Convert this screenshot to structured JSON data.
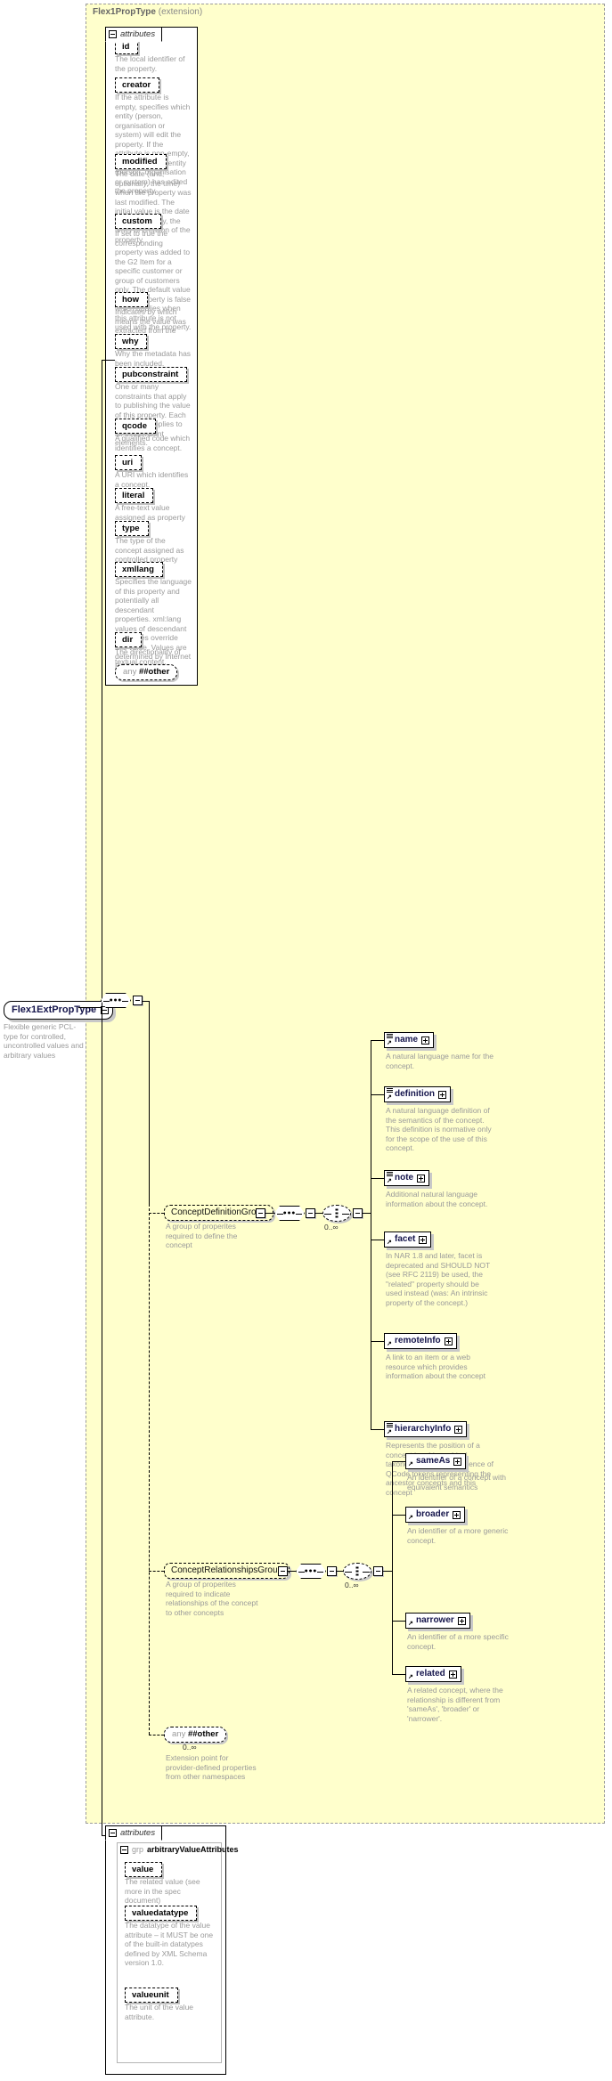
{
  "diagram": {
    "kind": "xml-schema-element-diagram",
    "root": {
      "name": "Flex1ExtPropType",
      "doc": "Flexible generic PCL-type for controlled, uncontrolled values and arbitrary values",
      "toggle": "minus"
    },
    "extension_panel": {
      "title": "Flex1PropType",
      "title_suffix": "(extension)"
    },
    "attributes_label": "attributes",
    "attributes": [
      {
        "name": "id",
        "doc": "The local identifier of the property."
      },
      {
        "name": "creator",
        "doc": "If the attribute is empty, specifies which entity (person, organisation or system) will edit the property. If the attribute is non-empty, specifies which entity (person, organisation or system) has edited the property."
      },
      {
        "name": "modified",
        "doc": "The date (and, optionally, the time) when the property was last modified. The initial value is the date (and, optionally, the time) of creation of the property."
      },
      {
        "name": "custom",
        "doc": "If set to true the corresponding property was added to the G2 Item for a specific customer or group of customers only. The default value of this property is false which applies when this attribute is not used with the property."
      },
      {
        "name": "how",
        "doc": "Indicates by which means the value was extracted from the content."
      },
      {
        "name": "why",
        "doc": "Why the metadata has been included."
      },
      {
        "name": "pubconstraint",
        "doc": "One or many constraints that apply to publishing the value of this property. Each constraint applies to all descendant elements."
      },
      {
        "name": "qcode",
        "doc": "A qualified code which identifies a concept."
      },
      {
        "name": "uri",
        "doc": "A URI which identifies a concept."
      },
      {
        "name": "literal",
        "doc": "A free-text value assigned as property value."
      },
      {
        "name": "type",
        "doc": "The type of the concept assigned as controlled property value."
      },
      {
        "name": "xmllang",
        "doc": "Specifies the language of this property and potentially all descendant properties. xml:lang values of descendant properties override this value. Values are determined by Internet BCP 47."
      },
      {
        "name": "dir",
        "doc": "The directionality of textual content."
      }
    ],
    "attributes_any": {
      "keyword": "any",
      "namespace": "##other"
    },
    "groups": [
      {
        "name": "ConceptDefinitionGroup",
        "doc": "A group of properites required to define the concept",
        "occurrence": "0..∞",
        "elements": [
          {
            "name": "name",
            "doc": "A natural language name for the concept.",
            "toggle": "plus",
            "has_seq_glyph": true
          },
          {
            "name": "definition",
            "doc": "A natural language definition of the semantics of the concept. This definition is normative only for the scope of the use of this concept.",
            "toggle": "plus",
            "has_seq_glyph": true
          },
          {
            "name": "note",
            "doc": "Additional natural language information about the concept.",
            "toggle": "plus",
            "has_seq_glyph": true
          },
          {
            "name": "facet",
            "doc": "In NAR 1.8 and later, facet is deprecated and SHOULD NOT (see RFC 2119) be used, the \"related\" property should be used instead (was: An intrinsic property of the concept.)",
            "toggle": "plus",
            "has_seq_glyph": false
          },
          {
            "name": "remoteInfo",
            "doc": "A link to an item or a web resource which provides information about the concept",
            "toggle": "plus",
            "has_seq_glyph": false
          },
          {
            "name": "hierarchyInfo",
            "doc": "Represents the position of a concept in a hierarchical taxonomy tree by a sequence of QCode tokens representing the ancestor concepts and this concept",
            "toggle": "plus",
            "has_seq_glyph": true
          }
        ]
      },
      {
        "name": "ConceptRelationshipsGroup",
        "doc": "A group of properites required to indicate relationships of the concept to other concepts",
        "occurrence": "0..∞",
        "elements": [
          {
            "name": "sameAs",
            "doc": "An identifier of a concept with equivalent semantics",
            "toggle": "plus",
            "has_seq_glyph": false
          },
          {
            "name": "broader",
            "doc": "An identifier of a more generic concept.",
            "toggle": "plus",
            "has_seq_glyph": false
          },
          {
            "name": "narrower",
            "doc": "An identifier of a more specific concept.",
            "toggle": "plus",
            "has_seq_glyph": false
          },
          {
            "name": "related",
            "doc": "A related concept, where the relationship is different from 'sameAs', 'broader' or 'narrower'.",
            "toggle": "plus",
            "has_seq_glyph": false
          }
        ]
      }
    ],
    "content_any": {
      "keyword": "any",
      "namespace": "##other",
      "occurrence": "0..∞",
      "doc": "Extension point for provider-defined properties from other namespaces"
    },
    "bottom_attributes": {
      "label": "attributes",
      "group_keyword": "grp",
      "group_name": "arbitraryValueAttributes",
      "attributes": [
        {
          "name": "value",
          "doc": "The related value (see more in the spec document)"
        },
        {
          "name": "valuedatatype",
          "doc": "The datatype of the value attribute – it MUST be one of the built-in datatypes defined by XML Schema version 1.0."
        },
        {
          "name": "valueunit",
          "doc": "The unit of the value attribute."
        }
      ]
    }
  },
  "colors": {
    "panel_fill": "#ffffcc",
    "doc_text": "#9a9a9a",
    "element_text": "#14144b",
    "line": "#000000"
  }
}
